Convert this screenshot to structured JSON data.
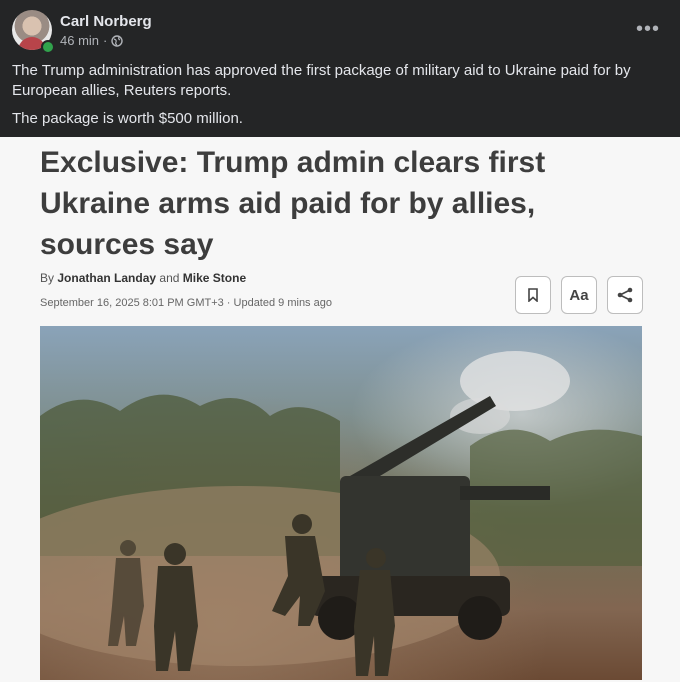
{
  "post": {
    "author": "Carl Norberg",
    "time": "46 min",
    "separator": "·",
    "visibility_icon": "globe-icon",
    "more_icon": "more-horizontal-icon",
    "more_glyph": "•••",
    "paragraphs": [
      "The Trump administration has approved the first package of military aid to Ukraine paid for by European allies, Reuters reports.",
      "The package is worth $500 million."
    ]
  },
  "article": {
    "headline_lines": [
      "Exclusive: Trump admin clears first",
      "Ukraine arms aid paid for by allies,",
      "sources say"
    ],
    "by": "By",
    "author1": "Jonathan Landay",
    "and": "and",
    "author2": "Mike Stone",
    "dateline": "September 16, 2025 8:01 PM GMT+3 · Updated 9 mins ago",
    "text_size_label": "Aa",
    "photo_alt": "artillery-soldiers-photo"
  },
  "colors": {
    "background": "#242526",
    "text_primary": "#e4e6eb",
    "text_secondary": "#b0b3b8",
    "online": "#31a24c"
  }
}
